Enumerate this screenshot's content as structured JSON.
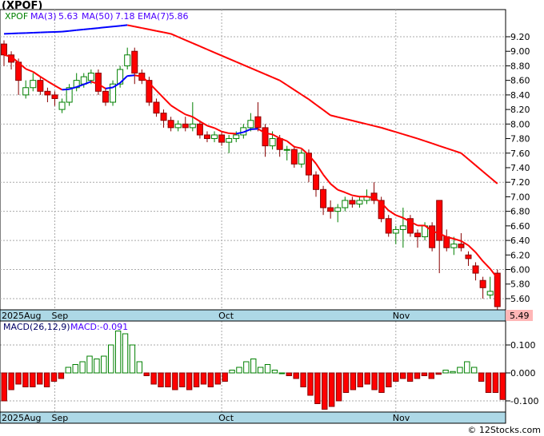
{
  "title": "(XPOF)",
  "legend": {
    "ticker": "XPOF",
    "ma3_label": "MA(3)",
    "ma3_value": "5.63",
    "ma50_label": "MA(50)",
    "ma50_value": "7.18",
    "ema7_label": "EMA(7)",
    "ema7_value": "5.86"
  },
  "last_price": "5.49",
  "macd_label": {
    "name": "MACD(26,12,9)",
    "value": "MACD:-0.091"
  },
  "credit": "© 12Stocks.com",
  "colors": {
    "up": "#008000",
    "down": "#ff0000",
    "ma_up": "#0000ff",
    "ma_down": "#ff0000",
    "axisband": "#add8e6",
    "price_tag": "#ffb6b6"
  },
  "chart_data": {
    "type": "candlestick",
    "x_month_labels": [
      {
        "label": "2025Aug",
        "index": -0.3
      },
      {
        "label": "Sep",
        "index": 7
      },
      {
        "label": "Oct",
        "index": 30
      },
      {
        "label": "Nov",
        "index": 54
      }
    ],
    "price_ticks": [
      "9.20",
      "9.00",
      "8.80",
      "8.60",
      "8.40",
      "8.20",
      "8.00",
      "7.80",
      "7.60",
      "7.40",
      "7.20",
      "7.00",
      "6.80",
      "6.60",
      "6.40",
      "6.20",
      "6.00",
      "5.80",
      "5.60"
    ],
    "ylim": [
      5.45,
      9.45
    ],
    "ohlc": [
      [
        9.1,
        9.15,
        8.8,
        8.95
      ],
      [
        8.95,
        9.0,
        8.75,
        8.85
      ],
      [
        8.85,
        8.9,
        8.4,
        8.6
      ],
      [
        8.4,
        8.6,
        8.35,
        8.5
      ],
      [
        8.5,
        8.7,
        8.45,
        8.6
      ],
      [
        8.6,
        8.65,
        8.4,
        8.45
      ],
      [
        8.45,
        8.5,
        8.3,
        8.4
      ],
      [
        8.4,
        8.45,
        8.25,
        8.35
      ],
      [
        8.2,
        8.35,
        8.15,
        8.3
      ],
      [
        8.3,
        8.55,
        8.25,
        8.5
      ],
      [
        8.5,
        8.7,
        8.45,
        8.6
      ],
      [
        8.55,
        8.7,
        8.5,
        8.65
      ],
      [
        8.6,
        8.75,
        8.55,
        8.7
      ],
      [
        8.7,
        8.75,
        8.4,
        8.45
      ],
      [
        8.45,
        8.5,
        8.25,
        8.3
      ],
      [
        8.3,
        8.6,
        8.25,
        8.55
      ],
      [
        8.55,
        8.8,
        8.5,
        8.75
      ],
      [
        8.8,
        9.05,
        8.75,
        8.95
      ],
      [
        9.0,
        9.05,
        8.55,
        8.7
      ],
      [
        8.7,
        8.75,
        8.55,
        8.6
      ],
      [
        8.6,
        8.65,
        8.25,
        8.3
      ],
      [
        8.3,
        8.35,
        8.1,
        8.15
      ],
      [
        8.15,
        8.2,
        7.95,
        8.05
      ],
      [
        8.05,
        8.1,
        7.9,
        7.95
      ],
      [
        7.95,
        8.05,
        7.9,
        8.0
      ],
      [
        8.0,
        8.1,
        7.9,
        7.95
      ],
      [
        7.95,
        8.3,
        7.9,
        8.0
      ],
      [
        8.0,
        8.05,
        7.8,
        7.85
      ],
      [
        7.85,
        7.9,
        7.75,
        7.8
      ],
      [
        7.8,
        7.9,
        7.75,
        7.85
      ],
      [
        7.85,
        7.9,
        7.7,
        7.75
      ],
      [
        7.75,
        7.85,
        7.6,
        7.8
      ],
      [
        7.8,
        7.9,
        7.75,
        7.85
      ],
      [
        7.85,
        8.0,
        7.8,
        7.95
      ],
      [
        7.95,
        8.15,
        7.9,
        8.05
      ],
      [
        8.1,
        8.3,
        7.9,
        7.95
      ],
      [
        7.95,
        8.0,
        7.55,
        7.7
      ],
      [
        7.7,
        7.9,
        7.65,
        7.8
      ],
      [
        7.8,
        7.85,
        7.55,
        7.65
      ],
      [
        7.65,
        7.7,
        7.5,
        7.65
      ],
      [
        7.65,
        7.7,
        7.4,
        7.45
      ],
      [
        7.45,
        7.65,
        7.4,
        7.6
      ],
      [
        7.6,
        7.65,
        7.2,
        7.3
      ],
      [
        7.3,
        7.35,
        7.0,
        7.1
      ],
      [
        7.1,
        7.15,
        6.75,
        6.85
      ],
      [
        6.85,
        6.95,
        6.7,
        6.8
      ],
      [
        6.8,
        6.9,
        6.65,
        6.85
      ],
      [
        6.85,
        7.0,
        6.8,
        6.95
      ],
      [
        6.95,
        7.0,
        6.85,
        6.9
      ],
      [
        6.9,
        7.0,
        6.85,
        6.95
      ],
      [
        6.95,
        7.1,
        6.9,
        7.0
      ],
      [
        7.05,
        7.2,
        6.9,
        6.95
      ],
      [
        6.95,
        7.0,
        6.65,
        6.7
      ],
      [
        6.7,
        6.75,
        6.45,
        6.5
      ],
      [
        6.5,
        6.6,
        6.35,
        6.55
      ],
      [
        6.55,
        6.85,
        6.3,
        6.6
      ],
      [
        6.7,
        6.75,
        6.45,
        6.5
      ],
      [
        6.5,
        6.55,
        6.3,
        6.45
      ],
      [
        6.45,
        6.65,
        6.4,
        6.6
      ],
      [
        6.6,
        6.65,
        6.25,
        6.3
      ],
      [
        6.95,
        6.95,
        5.95,
        6.4
      ],
      [
        6.45,
        6.55,
        6.25,
        6.3
      ],
      [
        6.3,
        6.45,
        6.2,
        6.35
      ],
      [
        6.35,
        6.5,
        6.25,
        6.3
      ],
      [
        6.2,
        6.25,
        6.05,
        6.15
      ],
      [
        6.05,
        6.1,
        5.85,
        5.95
      ],
      [
        5.85,
        5.9,
        5.6,
        5.75
      ],
      [
        5.65,
        5.9,
        5.6,
        5.7
      ],
      [
        5.95,
        6.0,
        5.45,
        5.49
      ]
    ],
    "ma50_points": [
      [
        0,
        9.24
      ],
      [
        8,
        9.27
      ],
      [
        17,
        9.36
      ],
      [
        23,
        9.24
      ],
      [
        30,
        8.94
      ],
      [
        38,
        8.6
      ],
      [
        42,
        8.34
      ],
      [
        45,
        8.12
      ],
      [
        52,
        7.95
      ],
      [
        57,
        7.8
      ],
      [
        63,
        7.6
      ],
      [
        68,
        7.18
      ]
    ],
    "macd_ticks": [
      "0.100",
      "0.000",
      "-0.100"
    ],
    "macd_ylim": [
      -0.145,
      0.17
    ],
    "macd_hist": [
      -0.1,
      -0.06,
      -0.04,
      -0.05,
      -0.05,
      -0.04,
      -0.05,
      -0.03,
      -0.02,
      0.02,
      0.03,
      0.04,
      0.06,
      0.05,
      0.06,
      0.1,
      0.15,
      0.14,
      0.1,
      0.04,
      -0.01,
      -0.04,
      -0.05,
      -0.05,
      -0.06,
      -0.05,
      -0.06,
      -0.05,
      -0.04,
      -0.05,
      -0.04,
      -0.03,
      0.01,
      0.02,
      0.04,
      0.05,
      0.02,
      0.03,
      0.01,
      0.0,
      -0.01,
      -0.02,
      -0.05,
      -0.08,
      -0.11,
      -0.13,
      -0.12,
      -0.1,
      -0.07,
      -0.06,
      -0.05,
      -0.04,
      -0.06,
      -0.07,
      -0.05,
      -0.03,
      -0.02,
      -0.03,
      -0.02,
      -0.01,
      -0.02,
      -0.005,
      0.01,
      0.005,
      0.02,
      0.04,
      0.02,
      -0.03,
      -0.07,
      -0.07,
      -0.095
    ]
  }
}
